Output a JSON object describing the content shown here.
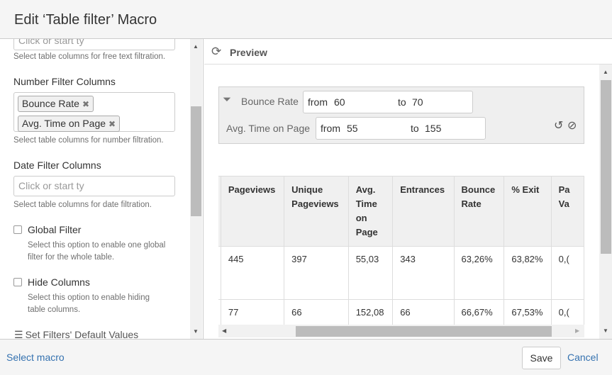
{
  "dialog": {
    "title": "Edit ‘Table filter’ Macro"
  },
  "left": {
    "text_filter": {
      "placeholder": "Click or start ty",
      "help": "Select table columns for free text filtration."
    },
    "number_filter": {
      "label": "Number Filter Columns",
      "tags": [
        "Bounce Rate",
        "Avg. Time on Page"
      ],
      "help": "Select table columns for number filtration."
    },
    "date_filter": {
      "label": "Date Filter Columns",
      "placeholder": "Click or start ty",
      "help": "Select table columns for date filtration."
    },
    "global_filter": {
      "label": "Global Filter",
      "checked": false,
      "help1": "Select this option to enable one global",
      "help2": "filter for the whole table."
    },
    "hide_columns": {
      "label": "Hide Columns",
      "checked": false,
      "help1": "Select this option to enable hiding",
      "help2": "table columns."
    },
    "default_values": {
      "label": "Set Filters' Default Values"
    }
  },
  "preview": {
    "title": "Preview",
    "filters": [
      {
        "label": "Bounce Rate",
        "from_label": "from",
        "from": "60",
        "to_label": "to",
        "to": "70"
      },
      {
        "label": "Avg. Time on Page",
        "from_label": "from",
        "from": "55",
        "to_label": "to",
        "to": "155"
      }
    ],
    "table": {
      "headers": [
        "Pageviews",
        "Unique Pageviews",
        "Avg. Time on Page",
        "Entrances",
        "Bounce Rate",
        "% Exit",
        "Pa Va"
      ],
      "rows": [
        [
          "445",
          "397",
          "55,03",
          "343",
          "63,26%",
          "63,82%",
          "0,("
        ],
        [
          "77",
          "66",
          "152,08",
          "66",
          "66,67%",
          "67,53%",
          "0,("
        ]
      ]
    }
  },
  "footer": {
    "select_macro": "Select macro",
    "save": "Save",
    "cancel": "Cancel"
  }
}
